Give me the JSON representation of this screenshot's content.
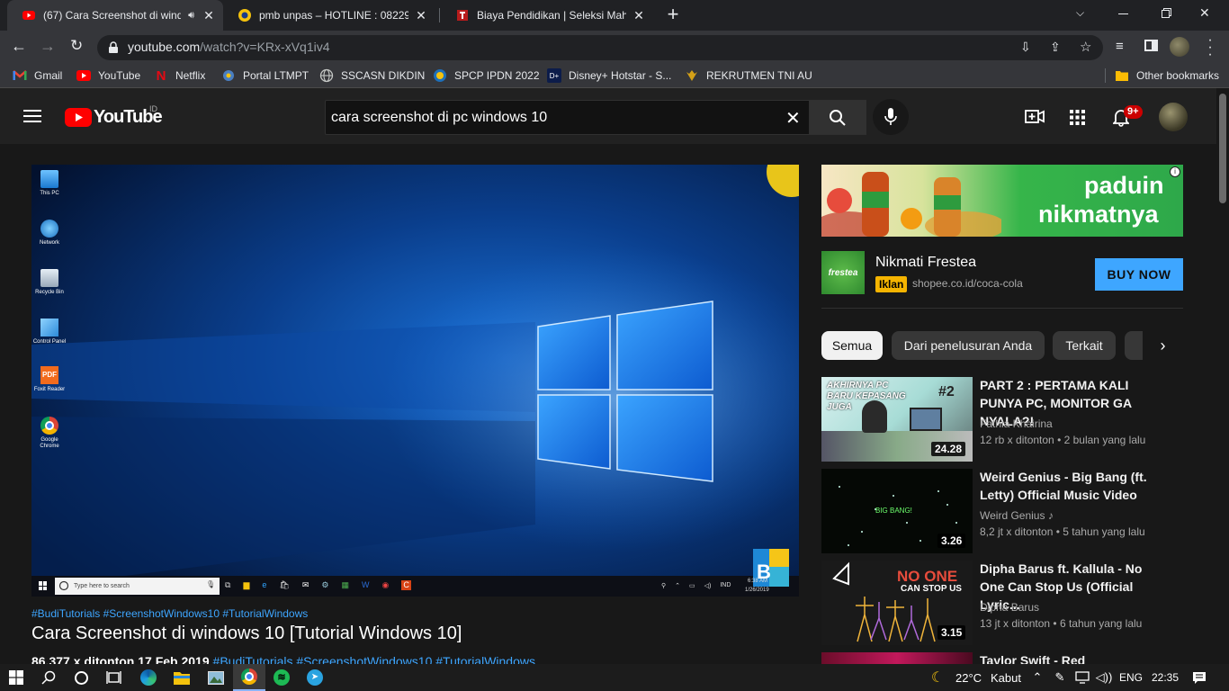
{
  "browser": {
    "tabs": [
      {
        "title": "(67) Cara Screenshot di windo",
        "icon": "youtube-icon",
        "active": true
      },
      {
        "title": "pmb unpas – HOTLINE : 0822954",
        "icon": "unpas-icon",
        "active": false
      },
      {
        "title": "Biaya Pendidikan | Seleksi Mahas",
        "icon": "telkom-icon",
        "active": false
      }
    ],
    "new_tab": "+",
    "url_host": "youtube.com",
    "url_path": "/watch?v=KRx-xVq1iv4",
    "bookmarks": [
      {
        "label": "Gmail",
        "icon": "gmail-icon"
      },
      {
        "label": "YouTube",
        "icon": "youtube-icon"
      },
      {
        "label": "Netflix",
        "icon": "netflix-icon"
      },
      {
        "label": "Portal LTMPT",
        "icon": "ltmpt-icon"
      },
      {
        "label": "SSCASN DIKDIN",
        "icon": "globe-icon"
      },
      {
        "label": "SPCP IPDN 2022",
        "icon": "ipdn-icon"
      },
      {
        "label": "Disney+ Hotstar - S...",
        "icon": "hotstar-icon"
      },
      {
        "label": "REKRUTMEN TNI AU",
        "icon": "tni-icon"
      }
    ],
    "other_bookmarks": "Other bookmarks"
  },
  "youtube": {
    "logo": "YouTube",
    "country": "ID",
    "search_value": "cara screenshot di pc windows 10",
    "notifications": "9+",
    "video": {
      "hashtags": "#BudiTutorials #ScreenshotWindows10 #TutorialWindows",
      "title": "Cara Screenshot di windows 10 [Tutorial Windows 10]",
      "meta": "86.377 x ditonton  17 Feb 2019",
      "meta_tags": "#BudiTutorials #ScreenshotWindows10 #TutorialWindows",
      "desktop_icons": [
        "This PC",
        "Network",
        "Recycle Bin",
        "Control Panel",
        "Foxit Reader",
        "Google Chrome"
      ],
      "search_placeholder": "Type here to search",
      "clock_time": "6:38 AM",
      "clock_date": "1/26/2019",
      "lang": "IND"
    },
    "ad": {
      "banner_line1": "paduin",
      "banner_line2": "nikmatnya",
      "title": "Nikmati Frestea",
      "badge": "Iklan",
      "url": "shopee.co.id/coca-cola",
      "cta": "BUY NOW",
      "brand": "frestea"
    },
    "chips": [
      "Semua",
      "Dari penelusuran Anda",
      "Terkait"
    ],
    "related": [
      {
        "title": "PART 2 : PERTAMA KALI PUNYA PC, MONITOR GA NYALA?!",
        "channel": "Fathia Khairina",
        "views": "12 rb x ditonton",
        "age": "2 bulan yang lalu",
        "duration": "24.28",
        "thumb_text": "AKHIRNYA PC BARU KEPASANG JUGA",
        "thumb_tag": "#2"
      },
      {
        "title": "Weird Genius - Big Bang (ft. Letty) Official Music Video",
        "channel": "Weird Genius",
        "views": "8,2 jt x ditonton",
        "age": "5 tahun yang lalu",
        "duration": "3.26",
        "thumb_text": "BIG BANG!"
      },
      {
        "title": "Dipha Barus ft. Kallula - No One Can Stop Us (Official Lyric...",
        "channel": "Dipha Barus",
        "views": "13 jt x ditonton",
        "age": "6 tahun yang lalu",
        "duration": "3.15",
        "thumb_text_1": "NO ONE",
        "thumb_text_2": "CAN STOP US"
      },
      {
        "title": "Taylor Swift - Red"
      }
    ]
  },
  "taskbar": {
    "temperature": "22°C",
    "weather": "Kabut",
    "lang": "ENG",
    "time": "22:35"
  }
}
